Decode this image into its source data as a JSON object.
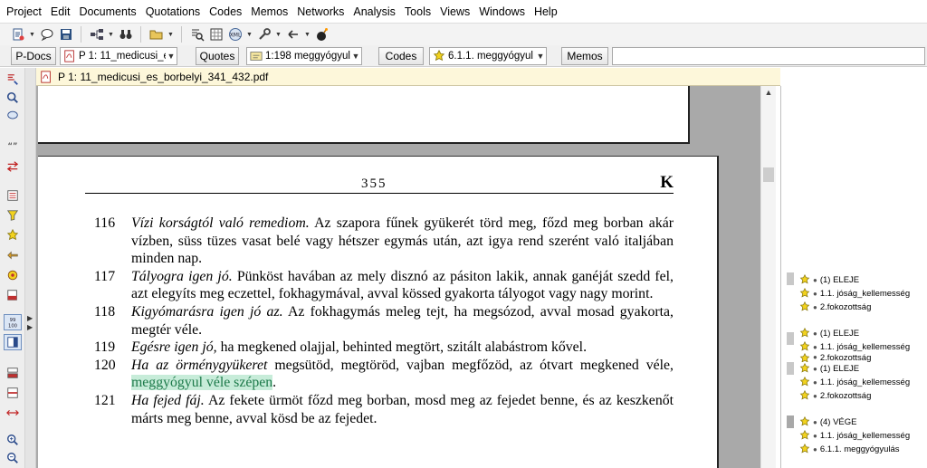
{
  "menu": [
    "Project",
    "Edit",
    "Documents",
    "Quotations",
    "Codes",
    "Memos",
    "Networks",
    "Analysis",
    "Tools",
    "Views",
    "Windows",
    "Help"
  ],
  "manager": {
    "pdocs_label": "P-Docs",
    "pdoc_selected": "P 1: 11_medicusi_e",
    "quotes_label": "Quotes",
    "quote_selected": "1:198 meggyógyul",
    "codes_label": "Codes",
    "code_selected": "6.1.1. meggyógyul",
    "memos_label": "Memos"
  },
  "document": {
    "title": "P 1: 11_medicusi_es_borbelyi_341_432.pdf"
  },
  "page": {
    "number": "355",
    "letter": "K",
    "entries": [
      {
        "num": "116",
        "title": "Vízi korságtól való remediom.",
        "text": " Az szapora fűnek gyükerét törd meg, főzd meg borban akár vízben, süss tüzes vasat belé vagy hétszer egymás után, azt igya rend szerént való italjában minden nap."
      },
      {
        "num": "117",
        "title": "Tályogra igen jó.",
        "text": " Pünköst havában az mely disznó az pásiton lakik, annak ganéját szedd fel, azt elegyíts meg eczettel, fokhagymával, avval kössed gyakorta tályogot vagy nagy morint."
      },
      {
        "num": "118",
        "title": "Kigyómarásra igen jó az.",
        "text": " Az fokhagymás meleg tejt, ha megsózod, avval mosad gyakorta, megtér véle."
      },
      {
        "num": "119",
        "title": "Egésre igen jó,",
        "text": " ha megkened olajjal, behinted megtört, szitált alabástrom kővel."
      },
      {
        "num": "120",
        "title": "Ha az örménygyükeret",
        "text": " megsütöd, megtöröd, vajban megfőzöd, az ótvart megkened véle, ",
        "highlight": "meggyógyul véle szépen",
        "tail": "."
      },
      {
        "num": "121",
        "title": "Ha fejed fáj.",
        "text": " Az fekete ürmöt főzd meg borban, mosd meg az fejedet benne, és az keszkenőt márts meg benne, avval kösd be az fejedet."
      }
    ]
  },
  "margin": {
    "codes": [
      {
        "label": "(1) ELEJE",
        "dot": true
      },
      {
        "label": "1.1. jóság_kellemesség"
      },
      {
        "label": "2.fokozottság"
      },
      {
        "label": "(1) ELEJE",
        "dot": true
      },
      {
        "label": "1.1. jóság_kellemesség"
      },
      {
        "label": "2.fokozottság"
      },
      {
        "label": "(1) ELEJE",
        "dot": true
      },
      {
        "label": "1.1. jóság_kellemesség"
      },
      {
        "label": "2.fokozottság"
      },
      {
        "label": "(4) VÉGE",
        "dot": true
      },
      {
        "label": "1.1. jóság_kellemesség"
      },
      {
        "label": "6.1.1. meggyógyulás"
      }
    ]
  },
  "colors": {
    "highlight_bg": "#c7ecd9",
    "highlight_fg": "#1d7a4a",
    "doc_strip": "#fdf7da",
    "code_star": "#f2d21e"
  }
}
